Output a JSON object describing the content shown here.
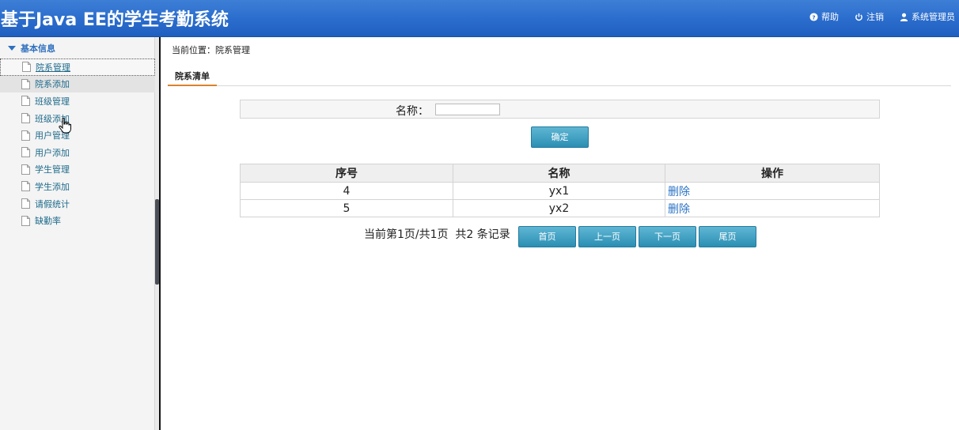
{
  "header": {
    "title": "基于Java EE的学生考勤系统",
    "links": [
      {
        "label": "帮助",
        "icon": "help-icon"
      },
      {
        "label": "注销",
        "icon": "power-icon"
      },
      {
        "label": "系统管理员",
        "icon": "user-icon"
      }
    ]
  },
  "sidebar": {
    "group_title": "基本信息",
    "items": [
      {
        "label": "院系管理"
      },
      {
        "label": "院系添加"
      },
      {
        "label": "班级管理"
      },
      {
        "label": "班级添加"
      },
      {
        "label": "用户管理"
      },
      {
        "label": "用户添加"
      },
      {
        "label": "学生管理"
      },
      {
        "label": "学生添加"
      },
      {
        "label": "请假统计"
      },
      {
        "label": "缺勤率"
      }
    ]
  },
  "main": {
    "breadcrumb": "当前位置：院系管理",
    "tab": "院系清单",
    "search": {
      "label": "名称：",
      "value": ""
    },
    "confirm_label": "确定",
    "table": {
      "headers": [
        "序号",
        "名称",
        "操作"
      ],
      "rows": [
        {
          "id": "4",
          "name": "yx1",
          "action": "删除"
        },
        {
          "id": "5",
          "name": "yx2",
          "action": "删除"
        }
      ]
    },
    "pager": {
      "status": "当前第1页/共1页  共2 条记录",
      "first": "首页",
      "prev": "上一页",
      "next": "下一页",
      "last": "尾页"
    }
  },
  "colors": {
    "header_blue": "#2a6ccc",
    "button_blue": "#2b8fb3",
    "link_blue": "#2b73c4",
    "menu_text": "#1d6a8b",
    "tab_underline": "#d9822b"
  }
}
